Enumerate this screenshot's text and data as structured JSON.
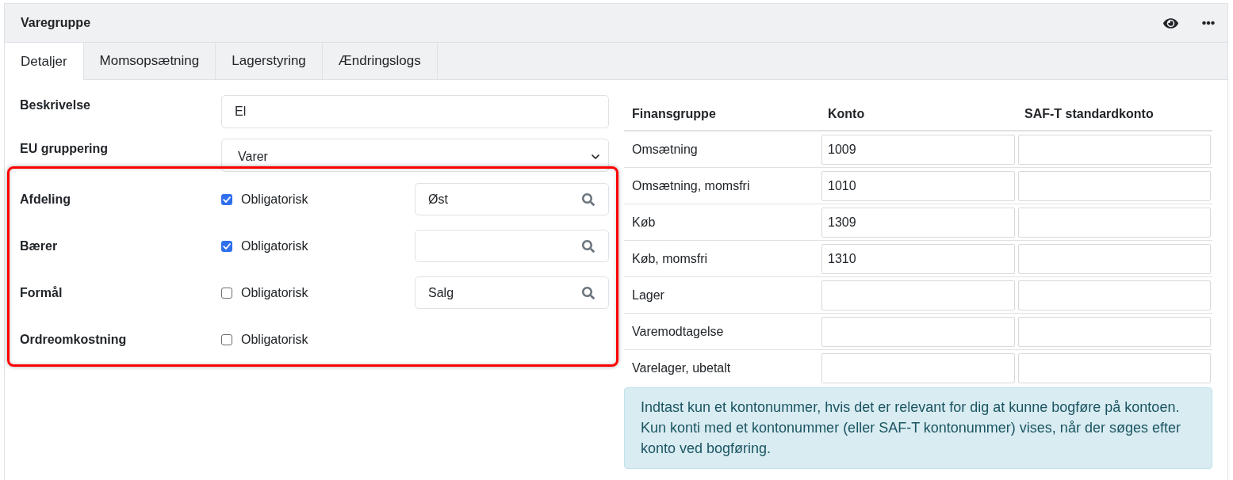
{
  "panel": {
    "title": "Varegruppe"
  },
  "tabs": [
    {
      "label": "Detaljer",
      "selected": true
    },
    {
      "label": "Momsopsætning",
      "selected": false
    },
    {
      "label": "Lagerstyring",
      "selected": false
    },
    {
      "label": "Ændringslogs",
      "selected": false
    }
  ],
  "form": {
    "fields": [
      {
        "kind": "text",
        "label": "Beskrivelse",
        "value": "El"
      },
      {
        "kind": "select",
        "label": "EU gruppering",
        "value": "Varer"
      }
    ],
    "dimensions": {
      "highlighted": true,
      "rows": [
        {
          "kind": "search",
          "label": "Afdeling",
          "checkbox_label": "Obligatorisk",
          "checked": true,
          "value": "Øst"
        },
        {
          "kind": "search",
          "label": "Bærer",
          "checkbox_label": "Obligatorisk",
          "checked": true
        },
        {
          "kind": "search",
          "label": "Formål",
          "checkbox_label": "Obligatorisk",
          "checked": false,
          "value": "Salg"
        },
        {
          "kind": "plain",
          "label": "Ordreomkostning",
          "checkbox_label": "Obligatorisk",
          "checked": false
        }
      ]
    }
  },
  "accounts": {
    "columns": [
      "Finansgruppe",
      "Konto",
      "SAF-T standardkonto"
    ],
    "rows": [
      {
        "group": "Omsætning",
        "account": "1009"
      },
      {
        "group": "Omsætning, momsfri",
        "account": "1010"
      },
      {
        "group": "Køb",
        "account": "1309"
      },
      {
        "group": "Køb, momsfri",
        "account": "1310"
      },
      {
        "group": "Lager"
      },
      {
        "group": "Varemodtagelse"
      },
      {
        "group": "Varelager, ubetalt"
      }
    ]
  },
  "info": "Indtast kun et kontonummer, hvis det er relevant for dig at kunne bogføre på kontoen. Kun konti med et kontonummer (eller SAF-T kontonummer) vises, når der søges efter konto ved bogføring."
}
